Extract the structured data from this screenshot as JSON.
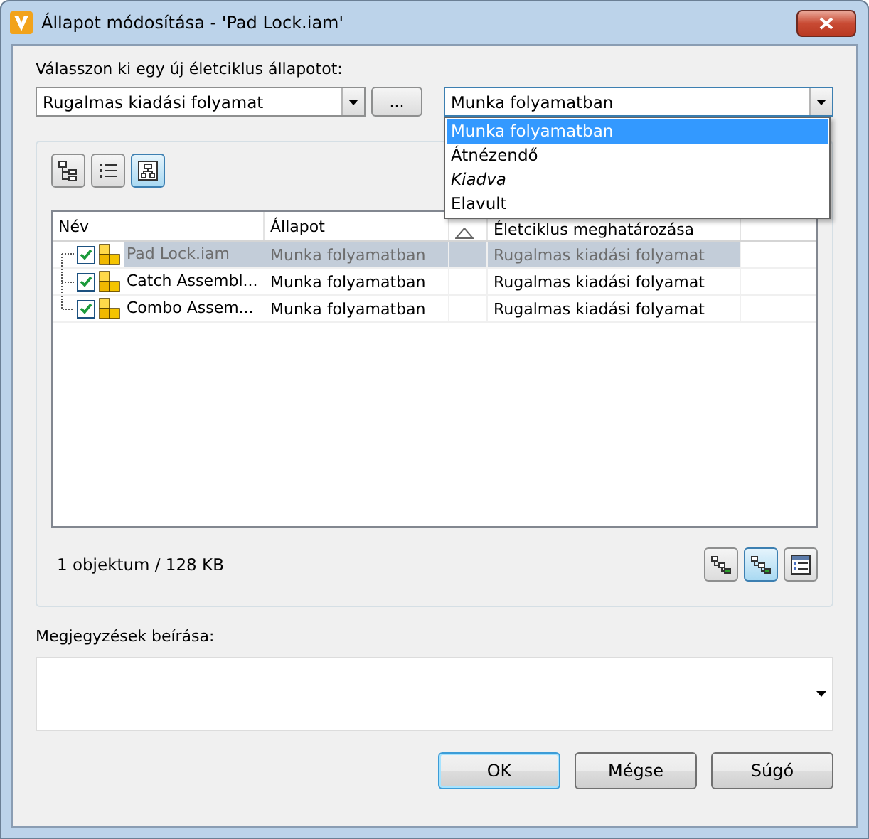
{
  "window": {
    "title": "Állapot módosítása - 'Pad Lock.iam'"
  },
  "lifecycle_label": "Válasszon ki egy új életciklus állapotot:",
  "definition_select": {
    "value": "Rugalmas kiadási folyamat"
  },
  "browse_button": "...",
  "state_select": {
    "value": "Munka folyamatban",
    "expanded": true,
    "options": [
      {
        "label": "Munka folyamatban",
        "selected": true,
        "italic": false
      },
      {
        "label": "Átnézendő",
        "selected": false,
        "italic": false
      },
      {
        "label": "Kiadva",
        "selected": false,
        "italic": true
      },
      {
        "label": "Elavult",
        "selected": false,
        "italic": false
      }
    ]
  },
  "view_buttons": [
    {
      "kind": "tree",
      "selected": false
    },
    {
      "kind": "list",
      "selected": false
    },
    {
      "kind": "structure",
      "selected": true
    }
  ],
  "table": {
    "columns": [
      "Név",
      "Állapot",
      "Életciklus meghatározása"
    ],
    "rows": [
      {
        "name": "Pad Lock.iam",
        "state": "Munka folyamatban",
        "definition": "Rugalmas kiadási folyamat",
        "checked": true,
        "selected": true
      },
      {
        "name": "Catch Assembl...",
        "state": "Munka folyamatban",
        "definition": "Rugalmas kiadási folyamat",
        "checked": true,
        "selected": false
      },
      {
        "name": "Combo Assem...",
        "state": "Munka folyamatban",
        "definition": "Rugalmas kiadási folyamat",
        "checked": true,
        "selected": false
      }
    ]
  },
  "status": "1 objektum / 128 KB",
  "footer_buttons": [
    {
      "kind": "links",
      "selected": false
    },
    {
      "kind": "links",
      "selected": true
    },
    {
      "kind": "details",
      "selected": false
    }
  ],
  "notes": {
    "label": "Megjegyzések beírása:"
  },
  "buttons": [
    {
      "label": "OK",
      "default": true
    },
    {
      "label": "Mégse",
      "default": false
    },
    {
      "label": "Súgó",
      "default": false
    }
  ]
}
